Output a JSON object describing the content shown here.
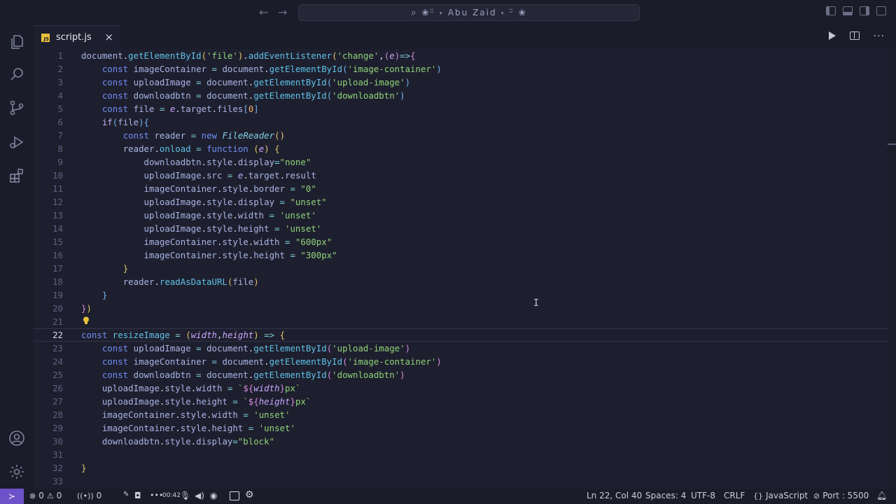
{
  "titlebar": {
    "search_text": "❀ᵕ̈ ˖ Abu Zaid ˖ ᵕ̈ ❀"
  },
  "tab": {
    "label": "script.js",
    "lang_badge": "JS"
  },
  "editor": {
    "lines": [
      {
        "n": "1"
      },
      {
        "n": "2"
      },
      {
        "n": "3"
      },
      {
        "n": "4"
      },
      {
        "n": "5"
      },
      {
        "n": "6"
      },
      {
        "n": "7"
      },
      {
        "n": "8"
      },
      {
        "n": "9"
      },
      {
        "n": "10"
      },
      {
        "n": "11"
      },
      {
        "n": "12"
      },
      {
        "n": "13"
      },
      {
        "n": "14"
      },
      {
        "n": "15"
      },
      {
        "n": "16"
      },
      {
        "n": "17"
      },
      {
        "n": "18"
      },
      {
        "n": "19"
      },
      {
        "n": "20"
      },
      {
        "n": "21"
      },
      {
        "n": "22"
      },
      {
        "n": "23"
      },
      {
        "n": "24"
      },
      {
        "n": "25"
      },
      {
        "n": "26"
      },
      {
        "n": "27"
      },
      {
        "n": "28"
      },
      {
        "n": "29"
      },
      {
        "n": "30"
      },
      {
        "n": "31"
      },
      {
        "n": "32"
      },
      {
        "n": "33"
      }
    ],
    "current_line": 22
  },
  "status": {
    "errors": "0",
    "warnings": "0",
    "ports": "0",
    "recording_time": "00:42",
    "position": "Ln 22, Col 40",
    "spaces": "Spaces: 4",
    "encoding": "UTF-8",
    "eol": "CRLF",
    "language": "JavaScript",
    "port": "Port : 5500"
  }
}
